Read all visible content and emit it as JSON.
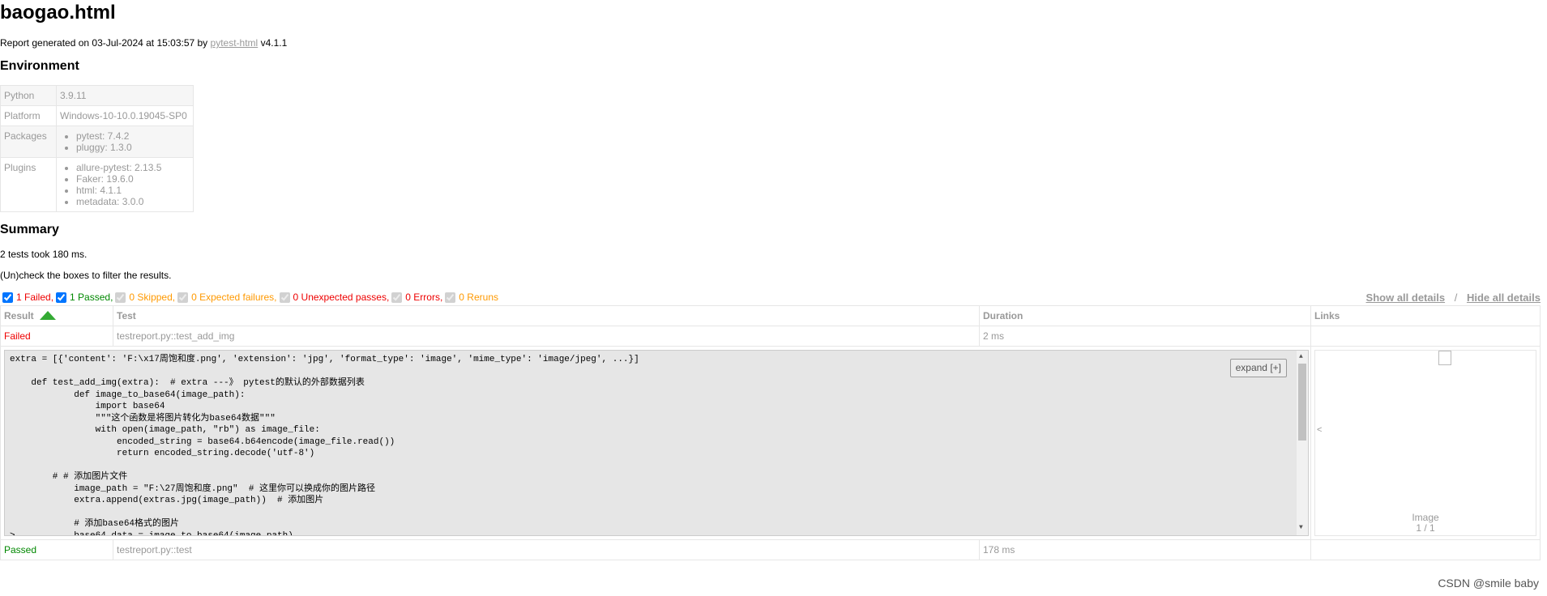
{
  "title": "baogao.html",
  "generated": {
    "prefix": "Report generated on 03-Jul-2024 at 15:03:57 by",
    "link": "pytest-html",
    "version": "v4.1.1"
  },
  "environment": {
    "heading": "Environment",
    "python": {
      "key": "Python",
      "value": "3.9.11"
    },
    "platform": {
      "key": "Platform",
      "value": "Windows-10-10.0.19045-SP0"
    },
    "packages": {
      "key": "Packages",
      "items": [
        "pytest: 7.4.2",
        "pluggy: 1.3.0"
      ]
    },
    "plugins": {
      "key": "Plugins",
      "items": [
        "allure-pytest: 2.13.5",
        "Faker: 19.6.0",
        "html: 4.1.1",
        "metadata: 3.0.0"
      ]
    }
  },
  "summary": {
    "heading": "Summary",
    "took": "2 tests took 180 ms.",
    "hint": "(Un)check the boxes to filter the results."
  },
  "filters": {
    "failed": "1 Failed,",
    "passed": "1 Passed,",
    "skipped": "0 Skipped,",
    "xfailed": "0 Expected failures,",
    "xpassed": "0 Unexpected passes,",
    "errors": "0 Errors,",
    "reruns": "0 Reruns"
  },
  "details": {
    "show": "Show all details",
    "slash": "/",
    "hide": "Hide all details"
  },
  "table": {
    "headers": {
      "result": "Result",
      "test": "Test",
      "duration": "Duration",
      "links": "Links"
    },
    "rows": [
      {
        "result": "Failed",
        "test": "testreport.py::test_add_img",
        "duration": "2 ms"
      },
      {
        "result": "Passed",
        "test": "testreport.py::test",
        "duration": "178 ms"
      }
    ]
  },
  "log": {
    "text": "extra = [{'content': 'F:\\x17周饱和度.png', 'extension': 'jpg', 'format_type': 'image', 'mime_type': 'image/jpeg', ...}]\n\n    def test_add_img(extra):  # extra ---》 pytest的默认的外部数据列表\n            def image_to_base64(image_path):\n                import base64\n                \"\"\"这个函数是将图片转化为base64数据\"\"\"\n                with open(image_path, \"rb\") as image_file:\n                    encoded_string = base64.b64encode(image_file.read())\n                    return encoded_string.decode('utf-8')\n\n        # # 添加图片文件\n            image_path = \"F:\\27周饱和度.png\"  # 这里你可以换成你的图片路径\n            extra.append(extras.jpg(image_path))  # 添加图片\n\n            # 添加base64格式的图片\n>           base64_data = image_to_base64(image_path)",
    "expand": "expand [+]"
  },
  "media": {
    "prev": "<",
    "caption": "Image",
    "counter": "1 / 1"
  },
  "watermark": "CSDN @smile baby"
}
